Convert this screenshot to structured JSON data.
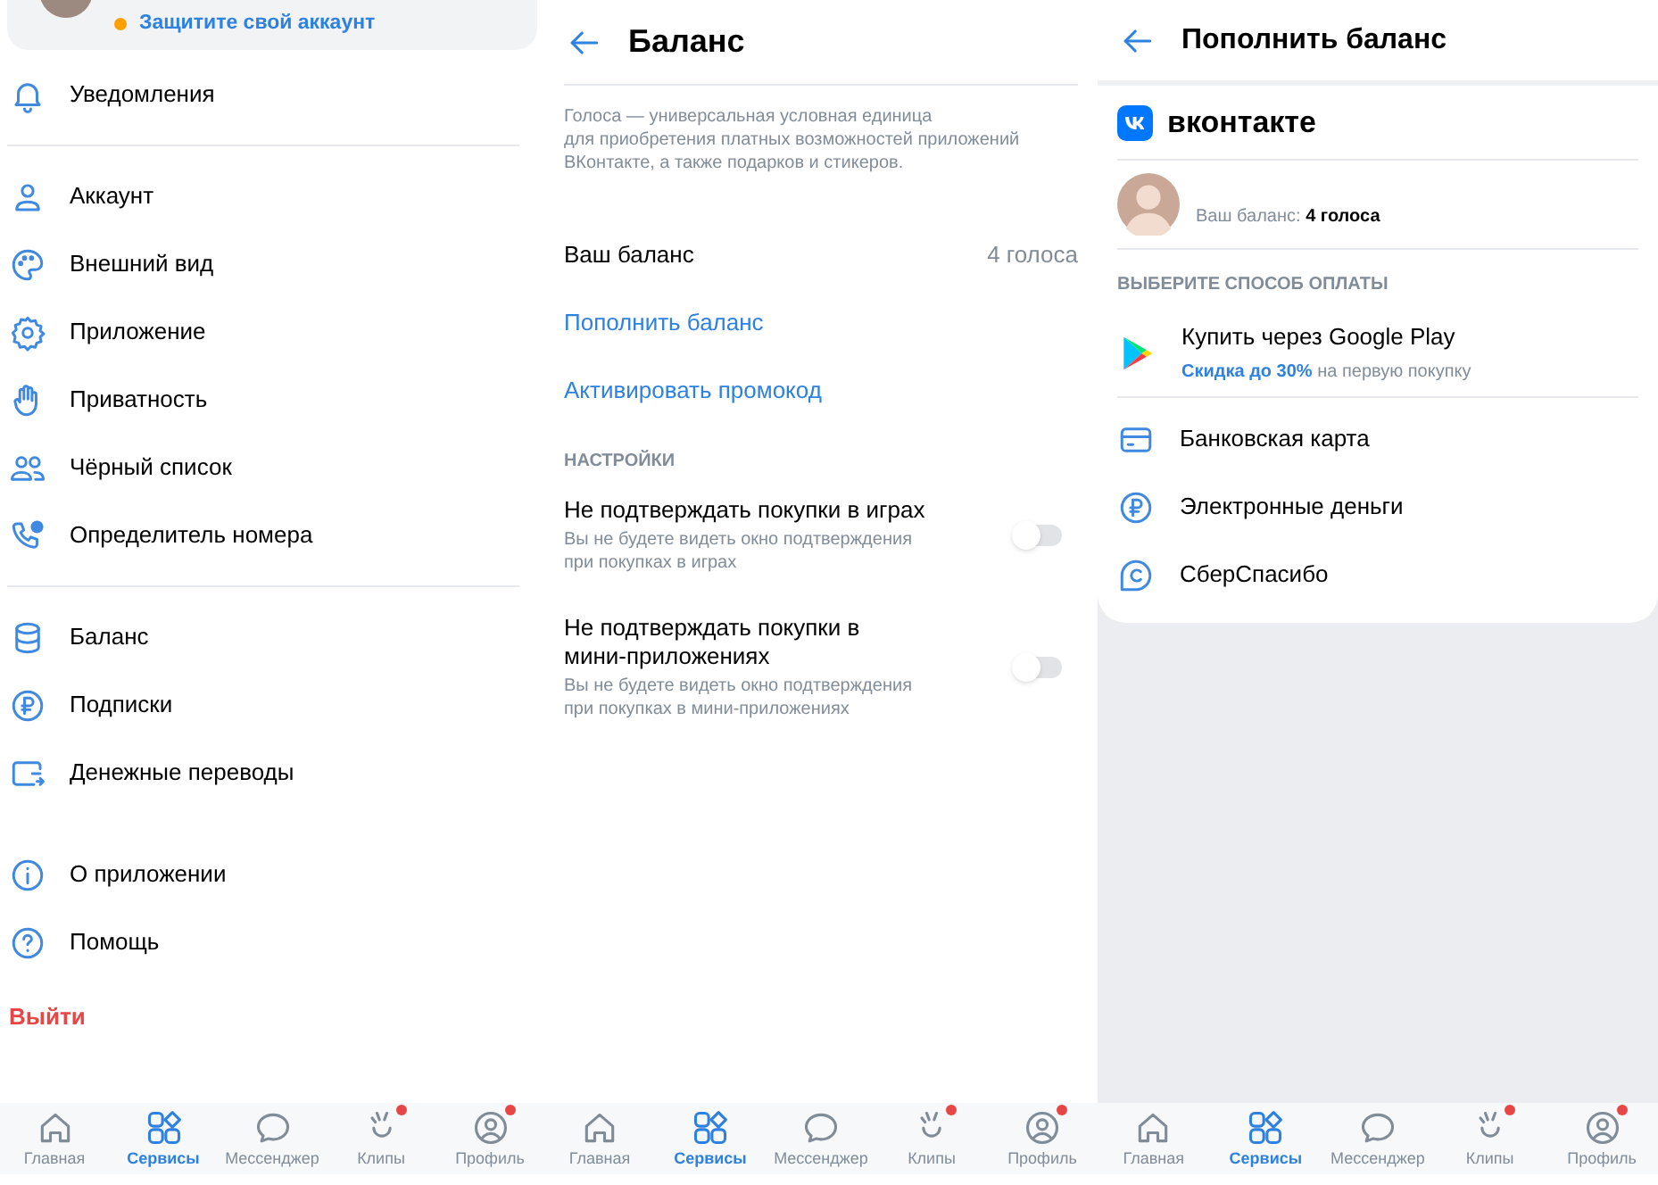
{
  "menu_screen": {
    "account_card": {
      "warning": "Защитите свой аккаунт"
    },
    "groups": [
      {
        "items": [
          {
            "label": "Уведомления"
          }
        ],
        "divider": true
      },
      {
        "items": [
          {
            "label": "Аккаунт"
          },
          {
            "label": "Внешний вид"
          },
          {
            "label": "Приложение"
          },
          {
            "label": "Приватность"
          },
          {
            "label": "Чёрный список"
          },
          {
            "label": "Определитель номера"
          }
        ],
        "divider": true
      },
      {
        "items": [
          {
            "label": "Баланс"
          },
          {
            "label": "Подписки"
          },
          {
            "label": "Денежные переводы"
          }
        ],
        "divider": false
      },
      {
        "items": [
          {
            "label": "О приложении"
          },
          {
            "label": "Помощь"
          }
        ],
        "divider": false
      }
    ],
    "logout": "Выйти",
    "bottom_nav": [
      {
        "label": "Главная",
        "selected": false,
        "notification_dot": false
      },
      {
        "label": "Сервисы",
        "selected": true,
        "notification_dot": false
      },
      {
        "label": "Мессенджер",
        "selected": false,
        "notification_dot": false
      },
      {
        "label": "Клипы",
        "selected": false,
        "notification_dot": true
      },
      {
        "label": "Профиль",
        "selected": false,
        "notification_dot": true
      }
    ]
  },
  "balance_screen": {
    "title": "Баланс",
    "description": "Голоса — универсальная условная единица\nдля приобретения платных возможностей приложений\nВКонтакте, а также подарков и стикеров.",
    "balance_label": "Ваш баланс",
    "balance_value": "4 голоса",
    "links": [
      "Пополнить баланс",
      "Активировать промокод"
    ],
    "section_title": "НАСТРОЙКИ",
    "toggles": [
      {
        "title": "Не подтверждать покупки в играх",
        "subtitle": "Вы не будете видеть окно подтверждения\nпри покупках в играх",
        "on": false
      },
      {
        "title": "Не подтверждать покупки в\nмини-приложениях",
        "subtitle": "Вы не будете видеть окно подтверждения\nпри покупках в мини-приложениях",
        "on": false
      }
    ],
    "bottom_nav": [
      {
        "label": "Главная",
        "selected": false,
        "notification_dot": false
      },
      {
        "label": "Сервисы",
        "selected": true,
        "notification_dot": false
      },
      {
        "label": "Мессенджер",
        "selected": false,
        "notification_dot": false
      },
      {
        "label": "Клипы",
        "selected": false,
        "notification_dot": true
      },
      {
        "label": "Профиль",
        "selected": false,
        "notification_dot": true
      }
    ]
  },
  "top_up_screen": {
    "title": "Пополнить баланс",
    "brand": "вконтакте",
    "balance_line": "Ваш баланс: **4 голоса**",
    "section_title": "ВЫБЕРИТЕ СПОСОБ ОПЛАТЫ",
    "methods": [
      {
        "kind": "play",
        "label": "Купить через Google Play",
        "subtitle": "**Скидка до 30%** на первую покупку"
      },
      {
        "kind": "card",
        "label": "Банковская карта"
      },
      {
        "kind": "ruble",
        "label": "Электронные деньги"
      },
      {
        "kind": "bubble",
        "label": "СберСпасибо"
      }
    ],
    "bottom_nav": [
      {
        "label": "Главная",
        "selected": false,
        "notification_dot": false
      },
      {
        "label": "Сервисы",
        "selected": true,
        "notification_dot": false
      },
      {
        "label": "Мессенджер",
        "selected": false,
        "notification_dot": false
      },
      {
        "label": "Клипы",
        "selected": false,
        "notification_dot": true
      },
      {
        "label": "Профиль",
        "selected": false,
        "notification_dot": true
      }
    ]
  }
}
